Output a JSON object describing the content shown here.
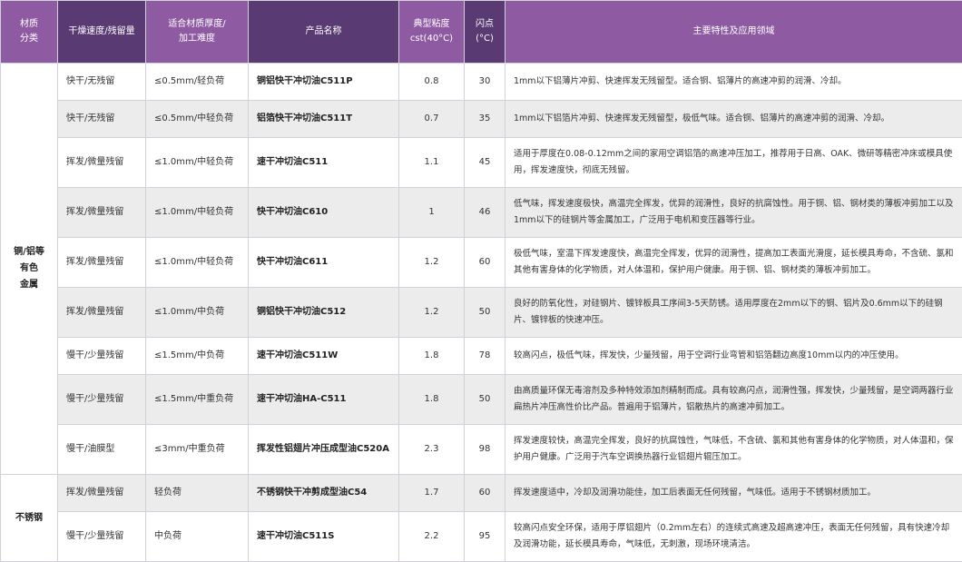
{
  "headers": {
    "category": "材质\n分类",
    "speed": "干燥速度/残留量",
    "thickness": "适合材质厚度/\n加工难度",
    "product": "产品名称",
    "viscosity": "典型粘度\ncst(40°C)",
    "flash": "闪点\n(°C)",
    "features": "主要特性及应用领域"
  },
  "groups": [
    {
      "category": "铜/铝等\n有色\n金属",
      "rows": [
        {
          "speed": "快干/无残留",
          "thickness": "≤0.5mm/轻负荷",
          "product": "铜铝快干冲切油C511P",
          "viscosity": "0.8",
          "flash": "30",
          "features": "1mm以下铝薄片冲剪、快速挥发无残留型。适合铜、铝薄片的高速冲剪的润滑、冷却。"
        },
        {
          "speed": "快干/无残留",
          "thickness": "≤0.5mm/中轻负荷",
          "product": "铝箔快干冲切油C511T",
          "viscosity": "0.7",
          "flash": "35",
          "features": "1mm以下铝箔片冲剪、快速挥发无残留型，极低气味。适合铜、铝薄片的高速冲剪的润滑、冷却。"
        },
        {
          "speed": "挥发/微量残留",
          "thickness": "≤1.0mm/中轻负荷",
          "product": "速干冲切油C511",
          "viscosity": "1.1",
          "flash": "45",
          "features": "适用于厚度在0.08-0.12mm之间的家用空调铝箔的高速冲压加工，推荐用于日高、OAK、微研等精密冲床或模具使用，挥发速度快，彻底无残留。"
        },
        {
          "speed": "挥发/微量残留",
          "thickness": "≤1.0mm/中轻负荷",
          "product": "快干冲切油C610",
          "viscosity": "1",
          "flash": "46",
          "features": "低气味，挥发速度极快，高温完全挥发，优异的润滑性，良好的抗腐蚀性。用于铜、铝、钢材类的薄板冲剪加工以及1mm以下的硅钢片等金属加工，广泛用于电机和变压器等行业。"
        },
        {
          "speed": "挥发/微量残留",
          "thickness": "≤1.0mm/中轻负荷",
          "product": "快干冲切油C611",
          "viscosity": "1.2",
          "flash": "60",
          "features": "极低气味，室温下挥发速度快，高温完全挥发，优异的润滑性，提高加工表面光滑度，延长模具寿命，不含硫、氯和其他有害身体的化学物质，对人体温和，保护用户健康。用于铜、铝、钢材类的薄板冲剪加工。"
        },
        {
          "speed": "挥发/微量残留",
          "thickness": "≤1.0mm/中负荷",
          "product": "铜铝快干冲切油C512",
          "viscosity": "1.2",
          "flash": "50",
          "features": "良好的防氧化性，对硅钢片、镀锌板具工序间3-5天防锈。适用厚度在2mm以下的铜、铝片及0.6mm以下的硅钢片、镀锌板的快速冲压。"
        },
        {
          "speed": "慢干/少量残留",
          "thickness": "≤1.5mm/中负荷",
          "product": "速干冲切油C511W",
          "viscosity": "1.8",
          "flash": "78",
          "features": "较高闪点，极低气味，挥发快，少量残留，用于空调行业弯管和铝箔翻边高度10mm以内的冲压使用。"
        },
        {
          "speed": "慢干/少量残留",
          "thickness": "≤1.5mm/中重负荷",
          "product": "速干冲切油HA-C511",
          "viscosity": "1.8",
          "flash": "50",
          "features": "由高质量环保无毒溶剂及多种特效添加剂精制而成。具有较高闪点，润滑性强，挥发快，少量残留，是空调两器行业扁热片冲压高性价比产品。普遍用于铝薄片，铝散热片的高速冲剪加工。"
        },
        {
          "speed": "慢干/油膜型",
          "thickness": "≤3mm/中重负荷",
          "product": "挥发性铝翅片冲压成型油C520A",
          "viscosity": "2.3",
          "flash": "98",
          "features": "挥发速度较快，高温完全挥发，良好的抗腐蚀性，气味低，不含硫、氯和其他有害身体的化学物质，对人体温和，保护用户健康。广泛用于汽车空调换热器行业铝翅片辊压加工。"
        }
      ]
    },
    {
      "category": "不锈钢",
      "rows": [
        {
          "speed": "挥发/微量残留",
          "thickness": "轻负荷",
          "product": "不锈钢快干冲剪成型油C54",
          "viscosity": "1.7",
          "flash": "60",
          "features": "挥发速度适中，冷却及润滑功能佳，加工后表面无任何残留，气味低。适用于不锈钢材质加工。"
        },
        {
          "speed": "慢干/少量残留",
          "thickness": "中负荷",
          "product": "速干冲切油C511S",
          "viscosity": "2.2",
          "flash": "95",
          "features": "较高闪点安全环保，适用于厚铝翅片（0.2mm左右）的连续式高速及超高速冲压，表面无任何残留，具有快速冷却及润滑功能，延长模具寿命，气味低，无刺激，现场环境清洁。"
        }
      ]
    }
  ]
}
